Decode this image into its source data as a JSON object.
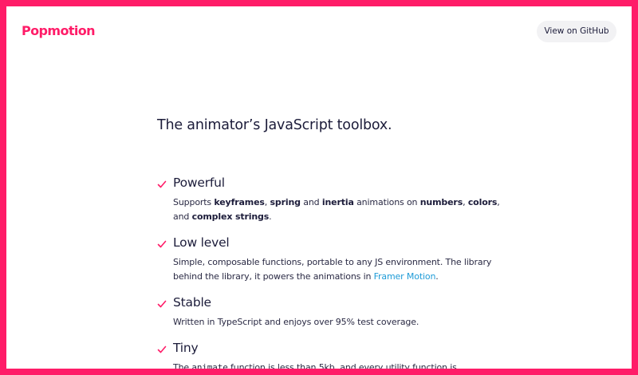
{
  "header": {
    "logo_text": "Popmotion",
    "github_button_label": "View on GitHub"
  },
  "tagline": "The animator’s JavaScript toolbox.",
  "features": [
    {
      "icon": "check-icon",
      "title": "Powerful",
      "desc": {
        "t1": "Supports ",
        "b1": "keyframes",
        "t2": ", ",
        "b2": "spring",
        "t3": " and ",
        "b3": "inertia",
        "t4": " animations on ",
        "b4": "numbers",
        "t5": ", ",
        "b5": "colors",
        "t6": ", and ",
        "b6": "complex strings",
        "t7": "."
      }
    },
    {
      "icon": "check-icon",
      "title": "Low level",
      "desc": {
        "t1": "Simple, composable functions, portable to any JS environment. The library behind the library, it powers the animations in ",
        "link": "Framer Motion",
        "t2": "."
      }
    },
    {
      "icon": "check-icon",
      "title": "Stable",
      "desc": {
        "t1": "Written in TypeScript and enjoys over 95% test coverage."
      }
    },
    {
      "icon": "check-icon",
      "title": "Tiny",
      "desc": {
        "t1": "The ",
        "code": "animate",
        "t2": " function is less than 5kb, and every utility function is"
      }
    }
  ],
  "colors": {
    "brand": "#ff1c68",
    "text": "#1c1c3a",
    "link": "#1e9bd7",
    "button_bg": "#f2f2f4"
  }
}
